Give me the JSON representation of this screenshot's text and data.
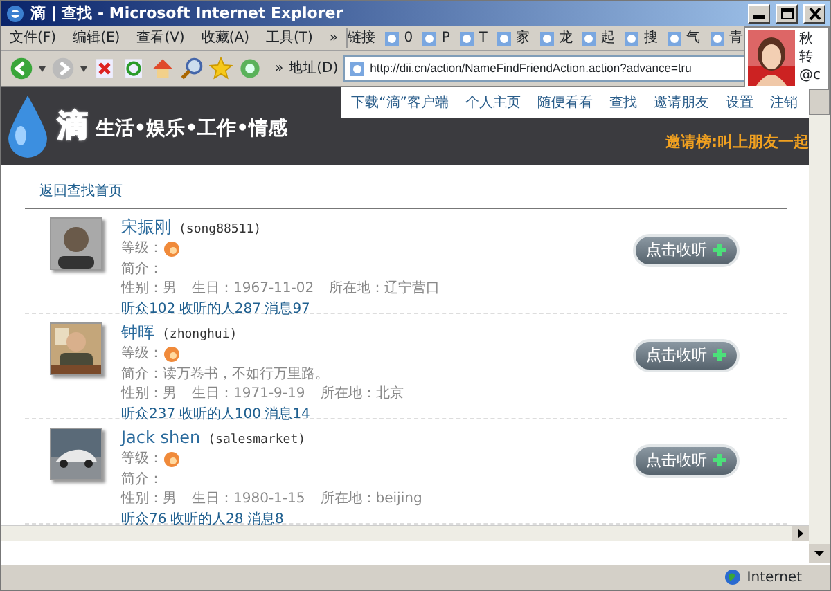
{
  "window": {
    "title": "滴 | 查找 - Microsoft Internet Explorer"
  },
  "menu": [
    "文件(F)",
    "编辑(E)",
    "查看(V)",
    "收藏(A)",
    "工具(T)"
  ],
  "menu_more": "»",
  "links_label": "链接",
  "links": [
    "0",
    "P",
    "T",
    "家",
    "龙",
    "起",
    "搜",
    "气",
    "青"
  ],
  "toolbar_more": "»",
  "address": {
    "label": "地址(D)",
    "value": "http://dii.cn/action/NameFindFriendAction.action?advance=tru"
  },
  "notification": {
    "lines": [
      "秋",
      "转",
      "@c"
    ]
  },
  "site": {
    "logo": "滴",
    "slogan": "生活•娱乐•工作•情感",
    "nav": [
      "下载“滴”客户端",
      "个人主页",
      "随便看看",
      "查找",
      "邀请朋友",
      "设置",
      "注销"
    ],
    "invite": "邀请榜:叫上朋友一起"
  },
  "back_link": "返回查找首页",
  "people": [
    {
      "name": "宋振刚",
      "username": "(song88511)",
      "level_label": "等级：",
      "intro_label": "简介：",
      "gender": "性别：男",
      "birthday": "生日：1967-11-02",
      "location": "所在地：辽宁营口",
      "stats": [
        "听众102",
        "收听的人287",
        "消息97"
      ],
      "button": "点击收听"
    },
    {
      "name": "钟晖",
      "username": "(zhonghui)",
      "level_label": "等级：",
      "intro_label": "简介：",
      "intro": "读万卷书，不如行万里路。",
      "gender": "性别：男",
      "birthday": "生日：1971-9-19",
      "location": "所在地：北京",
      "stats": [
        "听众237",
        "收听的人100",
        "消息14"
      ],
      "button": "点击收听"
    },
    {
      "name": "Jack shen",
      "username": "(salesmarket)",
      "level_label": "等级：",
      "intro_label": "简介：",
      "gender": "性别：男",
      "birthday": "生日：1980-1-15",
      "location": "所在地：beijing",
      "stats": [
        "听众76",
        "收听的人28",
        "消息8"
      ],
      "button": "点击收听"
    }
  ],
  "status_bar": {
    "zone": "Internet"
  }
}
